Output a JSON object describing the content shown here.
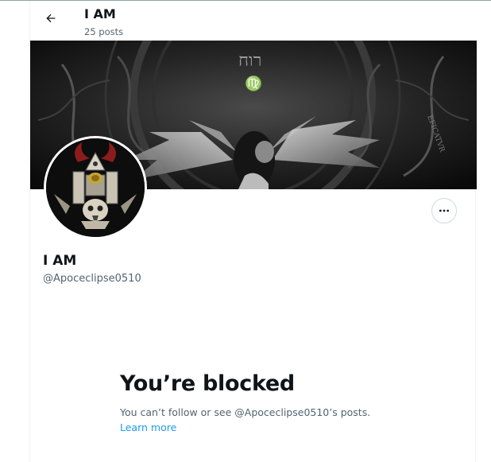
{
  "header": {
    "name": "I AM",
    "posts": "25 posts"
  },
  "banner": {
    "hebrew_text": "רוח"
  },
  "profile": {
    "name": "I AM",
    "handle": "@Apoceclipse0510"
  },
  "blocked": {
    "title": "You’re blocked",
    "message": "You can’t follow or see @Apoceclipse0510’s posts.",
    "learn_more": "Learn more"
  },
  "colors": {
    "text_primary": "#0f1419",
    "text_secondary": "#536471",
    "link": "#1d9bf0",
    "border": "#cfd9de"
  },
  "icons": {
    "back": "arrow-left-icon",
    "more": "more-horizontal-icon"
  }
}
